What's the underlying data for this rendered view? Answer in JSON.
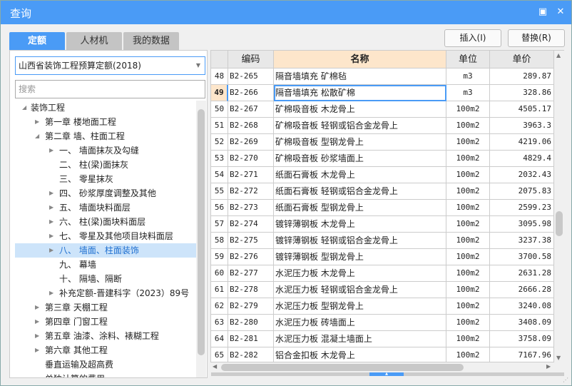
{
  "window": {
    "title": "查询",
    "restore_icon": "restore-icon",
    "close_icon": "close-icon"
  },
  "tabs": [
    {
      "label": "定额",
      "active": true
    },
    {
      "label": "人材机"
    },
    {
      "label": "我的数据"
    }
  ],
  "buttons": {
    "insert": "插入(I)",
    "replace": "替换(R)"
  },
  "library": {
    "selected": "山西省装饰工程预算定额(2018)"
  },
  "search": {
    "placeholder": "搜索",
    "value": ""
  },
  "tree": [
    {
      "label": "装饰工程",
      "level": 0,
      "expanded": true
    },
    {
      "label": "第一章 楼地面工程",
      "level": 1,
      "arrow": "right"
    },
    {
      "label": "第二章 墙、柱面工程",
      "level": 1,
      "arrow": "down"
    },
    {
      "label": "一、 墙面抹灰及勾缝",
      "level": 2,
      "arrow": "right"
    },
    {
      "label": "二、 柱(梁)面抹灰",
      "level": 2
    },
    {
      "label": "三、 零星抹灰",
      "level": 2
    },
    {
      "label": "四、 砂浆厚度调整及其他",
      "level": 2,
      "arrow": "right"
    },
    {
      "label": "五、 墙面块料面层",
      "level": 2,
      "arrow": "right"
    },
    {
      "label": "六、 柱(梁)面块料面层",
      "level": 2,
      "arrow": "right"
    },
    {
      "label": "七、 零星及其他项目块料面层",
      "level": 2,
      "arrow": "right"
    },
    {
      "label": "八、 墙面、柱面装饰",
      "level": 2,
      "arrow": "right",
      "selected": true
    },
    {
      "label": "九、 幕墙",
      "level": 2
    },
    {
      "label": "十、 隔墙、隔断",
      "level": 2
    },
    {
      "label": "补充定额-晋建科字（2023）89号",
      "level": 2,
      "arrow": "right"
    },
    {
      "label": "第三章 天棚工程",
      "level": 1,
      "arrow": "right"
    },
    {
      "label": "第四章 门窗工程",
      "level": 1,
      "arrow": "right"
    },
    {
      "label": "第五章 油漆、涂料、裱糊工程",
      "level": 1,
      "arrow": "right"
    },
    {
      "label": "第六章 其他工程",
      "level": 1,
      "arrow": "right"
    },
    {
      "label": "垂直运输及超高费",
      "level": 1
    },
    {
      "label": "单独计算的费用",
      "level": 1
    }
  ],
  "grid": {
    "columns": [
      "",
      "编码",
      "名称",
      "单位",
      "单价"
    ],
    "selected_row": "49",
    "rows": [
      [
        "48",
        "B2-265",
        "隔音墙填充 矿棉毡",
        "m3",
        "289.87"
      ],
      [
        "49",
        "B2-266",
        "隔音墙填充 松散矿棉",
        "m3",
        "328.86"
      ],
      [
        "50",
        "B2-267",
        "矿棉吸音板 木龙骨上",
        "100m2",
        "4505.17"
      ],
      [
        "51",
        "B2-268",
        "矿棉吸音板 轻钢或铝合金龙骨上",
        "100m2",
        "3963.3"
      ],
      [
        "52",
        "B2-269",
        "矿棉吸音板 型钢龙骨上",
        "100m2",
        "4219.06"
      ],
      [
        "53",
        "B2-270",
        "矿棉吸音板 砂浆墙面上",
        "100m2",
        "4829.4"
      ],
      [
        "54",
        "B2-271",
        "纸面石膏板 木龙骨上",
        "100m2",
        "2032.43"
      ],
      [
        "55",
        "B2-272",
        "纸面石膏板 轻钢或铝合金龙骨上",
        "100m2",
        "2075.83"
      ],
      [
        "56",
        "B2-273",
        "纸面石膏板 型钢龙骨上",
        "100m2",
        "2599.23"
      ],
      [
        "57",
        "B2-274",
        "镀锌薄钢板 木龙骨上",
        "100m2",
        "3095.98"
      ],
      [
        "58",
        "B2-275",
        "镀锌薄钢板 轻钢或铝合金龙骨上",
        "100m2",
        "3237.38"
      ],
      [
        "59",
        "B2-276",
        "镀锌薄钢板 型钢龙骨上",
        "100m2",
        "3700.58"
      ],
      [
        "60",
        "B2-277",
        "水泥压力板 木龙骨上",
        "100m2",
        "2631.28"
      ],
      [
        "61",
        "B2-278",
        "水泥压力板 轻钢或铝合金龙骨上",
        "100m2",
        "2666.28"
      ],
      [
        "62",
        "B2-279",
        "水泥压力板 型钢龙骨上",
        "100m2",
        "3240.08"
      ],
      [
        "63",
        "B2-280",
        "水泥压力板 砖墙面上",
        "100m2",
        "3408.09"
      ],
      [
        "64",
        "B2-281",
        "水泥压力板 混凝土墙面上",
        "100m2",
        "3758.09"
      ],
      [
        "65",
        "B2-282",
        "铝合金扣板 木龙骨上",
        "100m2",
        "7167.96"
      ]
    ]
  },
  "colors": {
    "accent": "#4a9bf6",
    "header_active": "#fde6cb",
    "tree_selected": "#cde4fa"
  }
}
